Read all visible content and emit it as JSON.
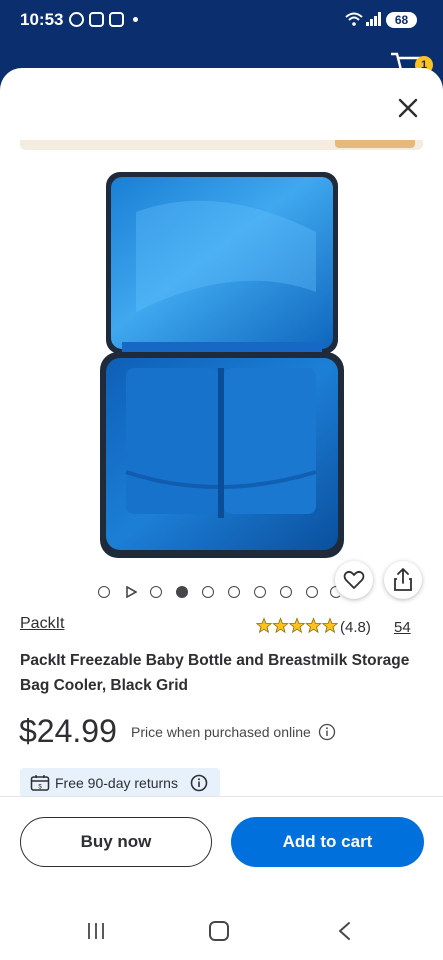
{
  "status_bar": {
    "time": "10:53",
    "battery": "68",
    "cart_count": "1"
  },
  "icons": {
    "status": [
      "whatsapp-icon",
      "instagram-icon",
      "instagram-icon"
    ],
    "close": "close-icon",
    "favorite": "heart-icon",
    "share": "share-icon",
    "info": "info-icon",
    "returns": "returns-icon"
  },
  "product": {
    "brand": "PackIt",
    "rating": "(4.8)",
    "review_count": "54",
    "stars": 5,
    "title": "PackIt Freezable Baby Bottle and Breastmilk Storage Bag Cooler, Black Grid",
    "price": "$24.99",
    "price_note": "Price when purchased online",
    "returns": "Free 90-day returns"
  },
  "carousel": {
    "count": 10,
    "active_index": 3
  },
  "actions": {
    "buy_now": "Buy now",
    "add_to_cart": "Add to cart"
  },
  "colors": {
    "header_blue": "#0b2e6e",
    "primary_blue": "#0071dc",
    "star_yellow": "#ffc220",
    "returns_bg": "#e6f1fc"
  }
}
